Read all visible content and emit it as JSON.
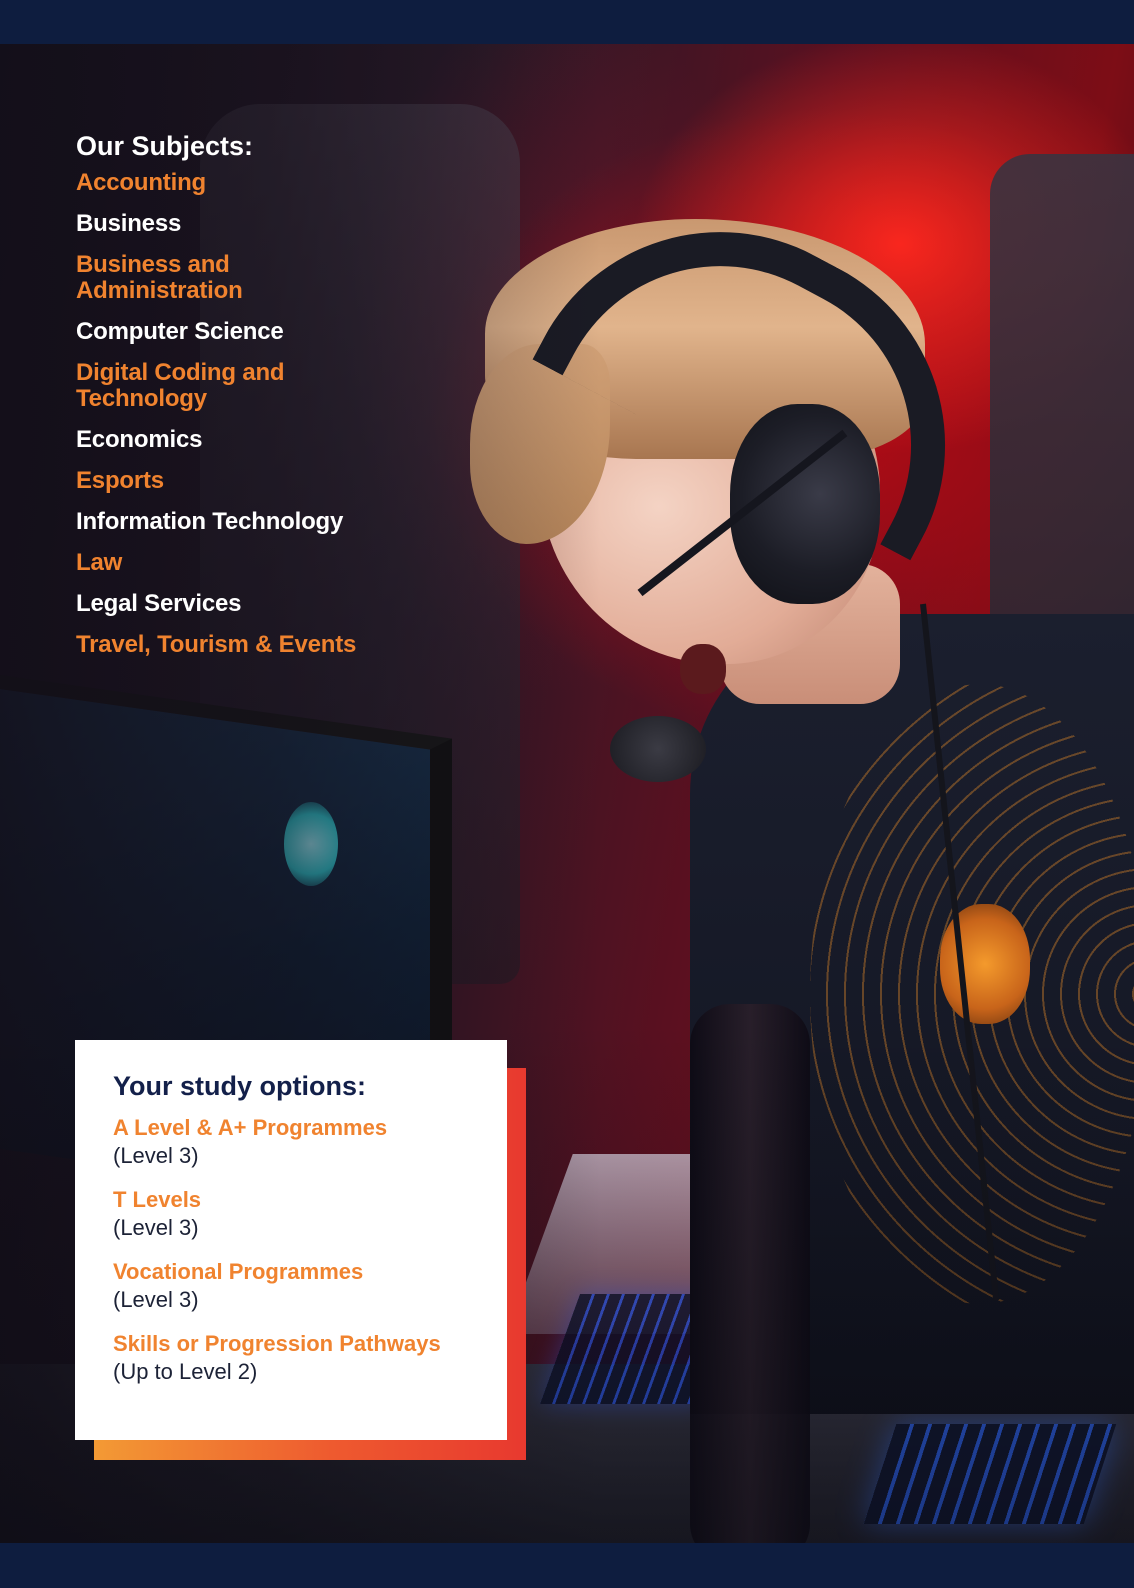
{
  "subjects": {
    "title": "Our Subjects:",
    "items": [
      {
        "label": "Accounting",
        "color": "#f0832f"
      },
      {
        "label": "Business",
        "color": "#ffffff"
      },
      {
        "label": "Business and Administration",
        "color": "#f0832f"
      },
      {
        "label": "Computer Science",
        "color": "#ffffff"
      },
      {
        "label": "Digital Coding and Technology",
        "color": "#f0832f"
      },
      {
        "label": "Economics",
        "color": "#ffffff"
      },
      {
        "label": "Esports",
        "color": "#f0832f"
      },
      {
        "label": "Information Technology",
        "color": "#ffffff"
      },
      {
        "label": "Law",
        "color": "#f0832f"
      },
      {
        "label": "Legal Services",
        "color": "#ffffff"
      },
      {
        "label": "Travel, Tourism & Events",
        "color": "#f0832f"
      }
    ]
  },
  "study_options": {
    "title": "Your study options:",
    "items": [
      {
        "name": "A Level & A+ Programmes",
        "level": "(Level 3)"
      },
      {
        "name": "T Levels",
        "level": "(Level 3)"
      },
      {
        "name": "Vocational Programmes",
        "level": "(Level 3)"
      },
      {
        "name": "Skills or Progression Pathways",
        "level": "(Up to Level 2)"
      }
    ]
  },
  "colors": {
    "navy": "#0e1d3f",
    "accent_orange": "#f0832f",
    "accent_red": "#e8392f",
    "text_dark": "#13204a"
  },
  "image": {
    "subject": "esports-player-photo"
  }
}
